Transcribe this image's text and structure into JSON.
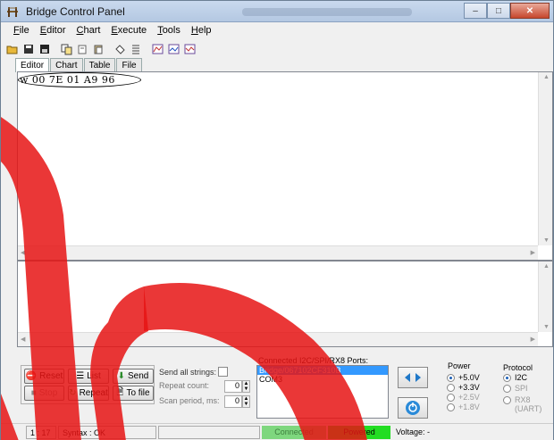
{
  "window": {
    "title": "Bridge Control Panel",
    "minimize": "–",
    "maximize": "□",
    "close": "✕"
  },
  "menu": [
    {
      "prefix": "",
      "u": "F",
      "rest": "ile"
    },
    {
      "prefix": "",
      "u": "E",
      "rest": "ditor"
    },
    {
      "prefix": "",
      "u": "C",
      "rest": "hart"
    },
    {
      "prefix": "",
      "u": "E",
      "rest": "xecute"
    },
    {
      "prefix": "",
      "u": "T",
      "rest": "ools"
    },
    {
      "prefix": "",
      "u": "H",
      "rest": "elp"
    }
  ],
  "toolbar_icons": [
    "open-icon",
    "save-icon",
    "save-as-icon",
    "copy-icon",
    "cut-icon",
    "paste-icon",
    "erase-icon",
    "list-icon",
    "chart1-icon",
    "chart2-icon",
    "chart3-icon"
  ],
  "tabs": [
    "Editor",
    "Chart",
    "Table",
    "File"
  ],
  "editor": {
    "command": "w 00 7E 01 A9 96"
  },
  "buttons": {
    "reset": "Reset",
    "list": "List",
    "send": "Send",
    "stop": "Stop",
    "repeat": "Repeat",
    "to_file": "To file"
  },
  "options": {
    "send_all_strings": "Send all strings:",
    "repeat_count": "Repeat count:",
    "repeat_count_value": "0",
    "scan_period": "Scan period, ms:",
    "scan_period_value": "0"
  },
  "ports": {
    "label": "Connected I2C/SPI/RX8 Ports:",
    "items": [
      "Bridge/067102CF310B",
      "COM3"
    ],
    "selected_index": 0
  },
  "power": {
    "title": "Power",
    "options": [
      "+5.0V",
      "+3.3V",
      "+2.5V",
      "+1.8V"
    ],
    "selected": "+5.0V"
  },
  "protocol": {
    "title": "Protocol",
    "options": [
      "I2C",
      "SPI",
      "RX8 (UART)"
    ],
    "selected": "I2C"
  },
  "status": {
    "position": "1 : 17",
    "syntax": "Syntax : OK",
    "connected": "Connected",
    "powered": "Powered",
    "voltage": "Voltage: -"
  }
}
